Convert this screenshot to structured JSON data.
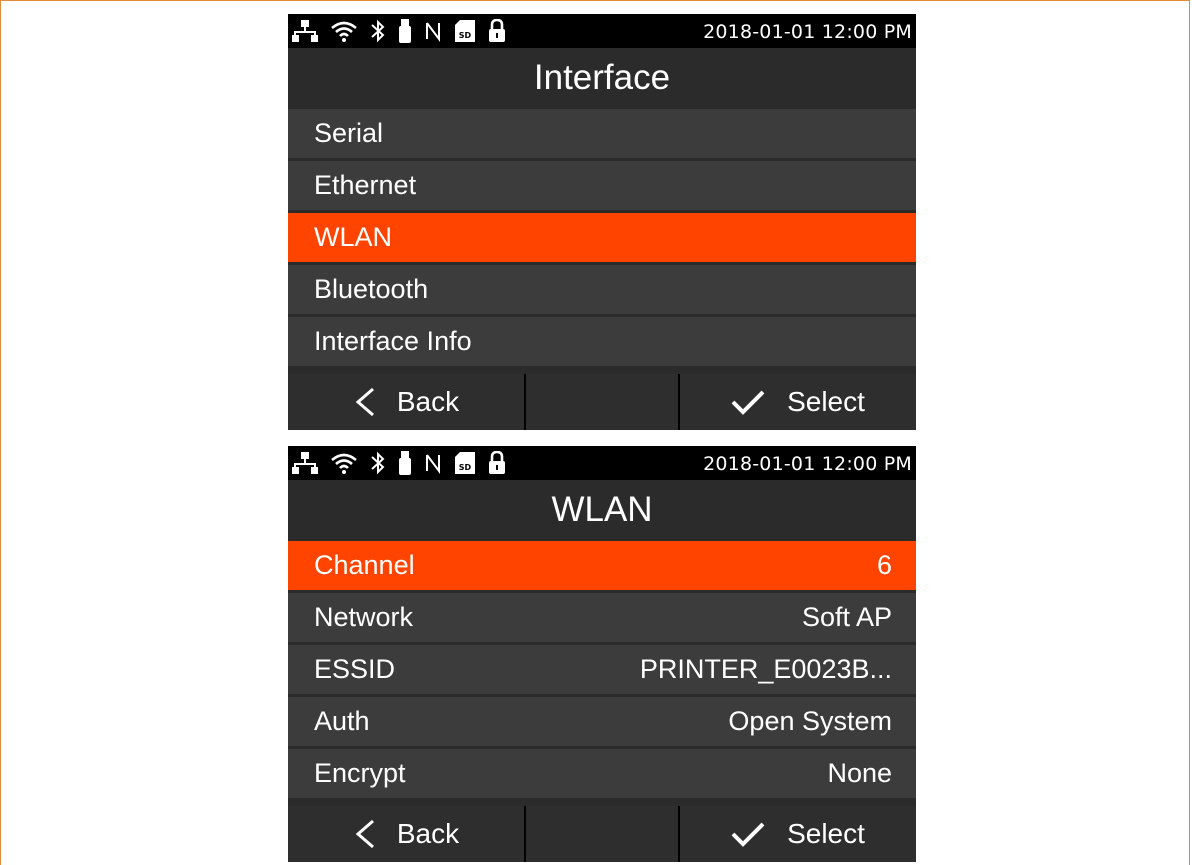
{
  "colors": {
    "accent": "#ff4400",
    "frame": "#e08a3a",
    "row_bg": "#3c3c3c",
    "screen_bg": "#2b2b2b",
    "statusbar_bg": "#000000"
  },
  "status_icons": [
    "network-icon",
    "wifi-icon",
    "bluetooth-icon",
    "usb-icon",
    "nfc-icon",
    "sd-card-icon",
    "lock-icon"
  ],
  "screen1": {
    "datetime": "2018-01-01 12:00 PM",
    "title": "Interface",
    "items": [
      {
        "label": "Serial",
        "selected": false
      },
      {
        "label": "Ethernet",
        "selected": false
      },
      {
        "label": "WLAN",
        "selected": true
      },
      {
        "label": "Bluetooth",
        "selected": false
      },
      {
        "label": "Interface Info",
        "selected": false
      }
    ],
    "buttons": {
      "back": "Back",
      "select": "Select"
    }
  },
  "screen2": {
    "datetime": "2018-01-01 12:00 PM",
    "title": "WLAN",
    "items": [
      {
        "label": "Channel",
        "value": "6",
        "selected": true
      },
      {
        "label": "Network",
        "value": "Soft AP",
        "selected": false
      },
      {
        "label": "ESSID",
        "value": "PRINTER_E0023B...",
        "selected": false
      },
      {
        "label": "Auth",
        "value": "Open System",
        "selected": false
      },
      {
        "label": "Encrypt",
        "value": "None",
        "selected": false
      }
    ],
    "buttons": {
      "back": "Back",
      "select": "Select"
    }
  }
}
